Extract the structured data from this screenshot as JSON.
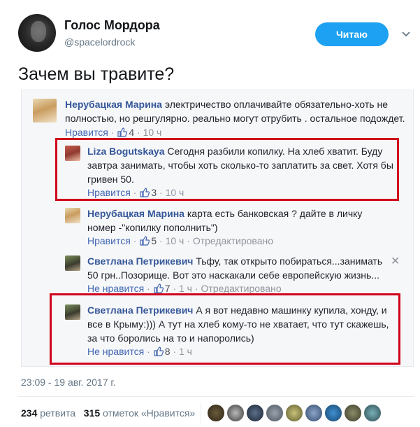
{
  "account": {
    "name": "Голос Мордора",
    "handle": "@spacelordrock"
  },
  "follow_label": "Читаю",
  "tweet": {
    "text": "Зачем вы травите?"
  },
  "comments": [
    {
      "author": "Нерубацкая Марина",
      "line1": "электричество оплачивайте обязательно-хоть не",
      "line2": "полностью, но решгулярно. реально могут отрубить . остальное подождет.",
      "like_label": "Нравится",
      "likes": "4",
      "time": "10 ч"
    },
    {
      "author": "Liza Bogutskaya",
      "line1": "Сегодня разбили копилку. На хлеб хватит. Буду",
      "line2": "завтра занимать, чтобы хоть сколько-то заплатить за свет. Хотя бы",
      "line3": "гривен 50.",
      "like_label": "Нравится",
      "likes": "3",
      "time": "10 ч"
    },
    {
      "author": "Нерубацкая Марина",
      "line1": "карта есть банковская ? дайте в личку",
      "line2": "номер -\"копилку пополнить\")",
      "like_label": "Нравится",
      "likes": "5",
      "time": "10 ч",
      "edited": "Отредактировано"
    },
    {
      "author": "Светлана Петрикевич",
      "line1": "Тьфу, так открыто побираться...занимать",
      "line2": "50 грн..Позорище. Вот это наскакали себе европейскую жизнь...",
      "like_label": "Не нравится",
      "likes": "7",
      "time": "1 ч",
      "edited": "Отредактировано"
    },
    {
      "author": "Светлана Петрикевич",
      "line1": "А я вот недавно машинку купила, хонду, и",
      "line2": "все в Крыму:))) А тут на хлеб кому-то не хватает, что тут скажешь,",
      "line3": "за что боролись на то и напоролись)",
      "like_label": "Не нравится",
      "likes": "8",
      "time": "1 ч"
    }
  ],
  "close_glyph": "✕",
  "timestamp": "23:09 - 19 авг. 2017 г.",
  "stats": {
    "retweets_count": "234",
    "retweets_label": "ретвита",
    "likes_count": "315",
    "likes_label": "отметок «Нравится»"
  },
  "colors": {
    "accent": "#1da1f2",
    "fb_link": "#365899",
    "highlight": "#d0021b"
  }
}
